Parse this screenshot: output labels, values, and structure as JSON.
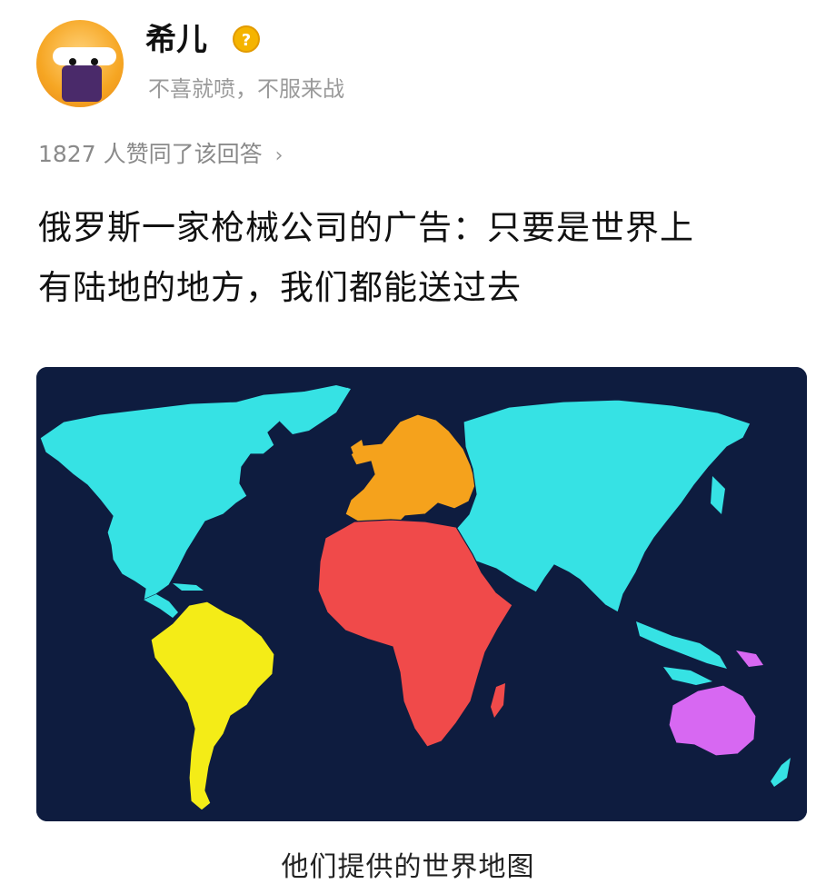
{
  "author": {
    "name": "希儿",
    "bio": "不喜就喷，不服来战"
  },
  "upvote_text": "1827 人赞同了该回答",
  "answer": {
    "line1": "俄罗斯一家枪械公司的广告：只要是世界上",
    "line2": "有陆地的地方，我们都能送过去"
  },
  "map": {
    "background": "#0e1c3f",
    "regions": [
      {
        "name": "North America & Asia",
        "color": "#36e2e4"
      },
      {
        "name": "Europe",
        "color": "#f5a21c"
      },
      {
        "name": "South America",
        "color": "#f4ec17"
      },
      {
        "name": "Africa",
        "color": "#f04a4a"
      },
      {
        "name": "Oceania",
        "color": "#d768f2"
      }
    ]
  },
  "caption": "他们提供的世界地图"
}
